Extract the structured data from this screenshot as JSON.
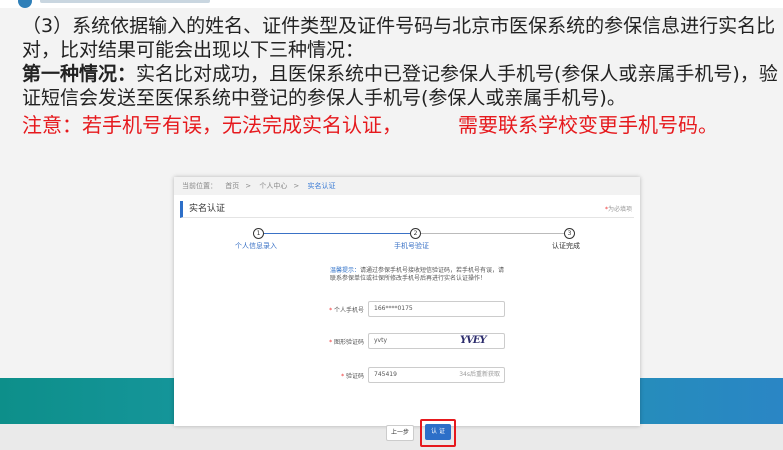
{
  "slide": {
    "line1": "（3）系统依据输入的姓名、证件类型及证件号码与北京市医保系统的参保信息进行实名比对，比对结果可能会出现以下三种情况：",
    "case_label": "第一种情况：",
    "case_text": "实名比对成功，且医保系统中已登记参保人手机号(参保人或亲属手机号)，验证短信会发送至医保系统中登记的参保人手机号(参保人或亲属手机号)。",
    "note_part1": "注意：若手机号有误，无法完成实名认证，",
    "note_part2": "需要联系学校变更手机号码。"
  },
  "colors": {
    "note_red": "#e6191d",
    "accent_blue": "#2d6fc8",
    "band_teal": "#0d8f8a"
  },
  "screenshot": {
    "breadcrumb": {
      "prefix": "当前位置：",
      "items": [
        "首页",
        "个人中心",
        "实名认证"
      ]
    },
    "panel_title": "实名认证",
    "required_note": "为必填项",
    "steps": [
      {
        "number": "1",
        "label": "个人信息录入"
      },
      {
        "number": "2",
        "label": "手机号验证"
      },
      {
        "number": "3",
        "label": "认证完成"
      }
    ],
    "tip_label": "温馨提示：",
    "tip_text": "请通过参保手机号接收短信验证码，若手机号有误，请联系参保单位或社保所修改手机号后再进行实名认证操作！",
    "fields": {
      "phone": {
        "label": "个人手机号",
        "value": "166****0175"
      },
      "captcha": {
        "label": "图形验证码",
        "value": "yvty",
        "image_text": "YVEY"
      },
      "sms": {
        "label": "验证码",
        "value": "745419",
        "button": "34s后重新获取"
      }
    },
    "buttons": {
      "prev": "上一步",
      "confirm": "认 证"
    }
  }
}
